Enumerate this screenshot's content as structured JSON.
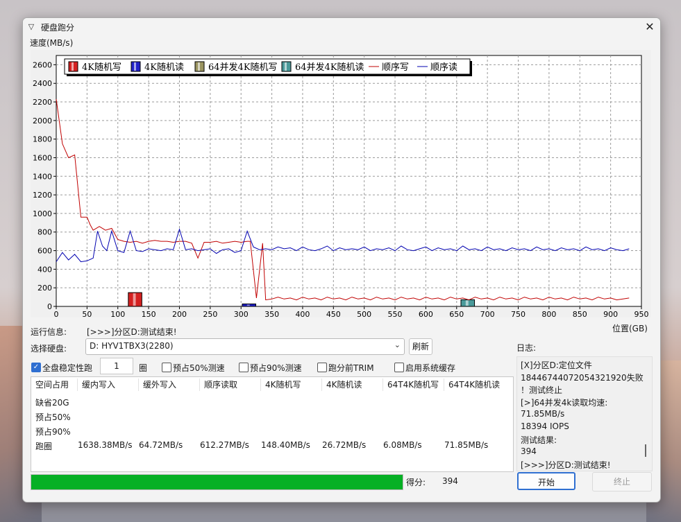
{
  "window": {
    "title": "硬盘跑分",
    "icon": "app-triangle-icon",
    "close_glyph": "✕"
  },
  "chart_data": {
    "type": "line",
    "ylabel": "速度(MB/s)",
    "xlabel": "位置(GB)",
    "xlim": [
      0,
      950
    ],
    "ylim": [
      0,
      2700
    ],
    "x_ticks": [
      0,
      50,
      100,
      150,
      200,
      250,
      300,
      350,
      400,
      450,
      500,
      550,
      600,
      650,
      700,
      750,
      800,
      850,
      900,
      950
    ],
    "y_ticks": [
      0,
      200,
      400,
      600,
      800,
      1000,
      1200,
      1400,
      1600,
      1800,
      2000,
      2200,
      2400,
      2600
    ],
    "grid": true,
    "legend_position": "top-left",
    "legend": [
      {
        "label": "4K随机写",
        "kind": "bar",
        "color": "#d42020"
      },
      {
        "label": "4K随机读",
        "kind": "bar",
        "color": "#2020c8"
      },
      {
        "label": "64并发4K随机写",
        "kind": "bar",
        "color": "#9a9460"
      },
      {
        "label": "64并发4K随机读",
        "kind": "bar",
        "color": "#4a9a9a"
      },
      {
        "label": "顺序写",
        "kind": "line",
        "color": "#c00000"
      },
      {
        "label": "顺序读",
        "kind": "line",
        "color": "#0000b0"
      }
    ],
    "bars": [
      {
        "series": "4K随机写",
        "x": 117,
        "width": 22,
        "value": 148.4,
        "color": "#d42020"
      },
      {
        "series": "4K随机读",
        "x": 302,
        "width": 22,
        "value": 26.7,
        "color": "#2020c8"
      },
      {
        "series": "64并发4K随机写",
        "x": 657,
        "width": 22,
        "value": 6.1,
        "color": "#9a9460"
      },
      {
        "series": "64并发4K随机读",
        "x": 657,
        "width": 22,
        "value": 71.9,
        "color": "#4a9a9a"
      }
    ],
    "series": [
      {
        "name": "顺序写",
        "color": "#c00000",
        "x": [
          0,
          10,
          20,
          30,
          40,
          50,
          55,
          60,
          70,
          80,
          90,
          100,
          110,
          120,
          130,
          140,
          150,
          160,
          170,
          180,
          190,
          200,
          210,
          220,
          230,
          240,
          250,
          260,
          270,
          280,
          290,
          300,
          310,
          315,
          325,
          335,
          340,
          350,
          360,
          370,
          380,
          390,
          400,
          410,
          420,
          430,
          440,
          450,
          460,
          470,
          480,
          490,
          500,
          510,
          520,
          530,
          540,
          550,
          560,
          570,
          580,
          590,
          600,
          610,
          620,
          630,
          640,
          650,
          660,
          670,
          680,
          690,
          700,
          710,
          720,
          730,
          740,
          750,
          760,
          770,
          780,
          790,
          800,
          810,
          820,
          830,
          840,
          850,
          860,
          870,
          880,
          890,
          900,
          910,
          920,
          930
        ],
        "values": [
          2230,
          1750,
          1600,
          1630,
          960,
          960,
          880,
          820,
          860,
          820,
          840,
          720,
          700,
          690,
          700,
          680,
          700,
          710,
          700,
          700,
          690,
          700,
          700,
          680,
          520,
          690,
          690,
          700,
          680,
          690,
          700,
          690,
          700,
          700,
          90,
          680,
          70,
          80,
          100,
          80,
          90,
          70,
          100,
          80,
          90,
          70,
          100,
          80,
          90,
          70,
          100,
          80,
          90,
          70,
          100,
          80,
          90,
          70,
          100,
          80,
          90,
          70,
          100,
          80,
          90,
          70,
          100,
          80,
          90,
          70,
          100,
          80,
          90,
          70,
          100,
          80,
          90,
          70,
          100,
          80,
          90,
          70,
          100,
          80,
          90,
          70,
          100,
          80,
          90,
          70,
          100,
          80,
          90,
          70,
          80,
          90
        ]
      },
      {
        "name": "顺序读",
        "color": "#0000b0",
        "x": [
          0,
          10,
          20,
          30,
          40,
          50,
          60,
          67,
          75,
          82,
          90,
          100,
          110,
          120,
          130,
          140,
          150,
          160,
          170,
          180,
          190,
          200,
          210,
          220,
          230,
          240,
          250,
          260,
          270,
          280,
          290,
          300,
          310,
          320,
          330,
          340,
          350,
          360,
          370,
          380,
          390,
          400,
          410,
          420,
          430,
          440,
          450,
          460,
          470,
          480,
          490,
          500,
          510,
          520,
          530,
          540,
          550,
          560,
          570,
          580,
          590,
          600,
          610,
          620,
          630,
          640,
          650,
          660,
          670,
          680,
          690,
          700,
          710,
          720,
          730,
          740,
          750,
          760,
          770,
          780,
          790,
          800,
          810,
          820,
          830,
          840,
          850,
          860,
          870,
          880,
          890,
          900,
          910,
          920,
          930
        ],
        "values": [
          480,
          580,
          500,
          560,
          480,
          490,
          520,
          810,
          650,
          600,
          810,
          600,
          580,
          810,
          600,
          590,
          620,
          610,
          600,
          620,
          610,
          830,
          610,
          620,
          600,
          610,
          620,
          570,
          610,
          620,
          580,
          600,
          810,
          640,
          610,
          620,
          610,
          640,
          620,
          630,
          600,
          640,
          610,
          600,
          620,
          650,
          600,
          630,
          610,
          620,
          610,
          640,
          600,
          620,
          610,
          630,
          600,
          650,
          610,
          600,
          620,
          640,
          600,
          630,
          610,
          620,
          600,
          650,
          610,
          620,
          600,
          640,
          610,
          620,
          600,
          630,
          610,
          620,
          600,
          640,
          610,
          620,
          600,
          630,
          610,
          620,
          600,
          640,
          610,
          620,
          600,
          630,
          610,
          600,
          620
        ]
      }
    ]
  },
  "info": {
    "run_label": "运行信息:",
    "run_value": "[>>>]分区D:测试结束!"
  },
  "disk": {
    "label": "选择硬盘:",
    "value": "D: HYV1TBX3(2280)",
    "refresh": "刷新"
  },
  "options": {
    "full_disk": {
      "label": "全盘稳定性跑",
      "checked": true
    },
    "rounds_value": "1",
    "rounds_unit": "圈",
    "pre50": {
      "label": "预占50%测速",
      "checked": false
    },
    "pre90": {
      "label": "预占90%测速",
      "checked": false
    },
    "trim": {
      "label": "跑分前TRIM",
      "checked": false
    },
    "cache": {
      "label": "启用系统缓存",
      "checked": false
    }
  },
  "table": {
    "headers": [
      "空间占用",
      "缓内写入",
      "缓外写入",
      "顺序读取",
      "4K随机写",
      "4K随机读",
      "64T4K随机写",
      "64T4K随机读"
    ],
    "rows": [
      [
        "缺省20G",
        "",
        "",
        "",
        "",
        "",
        "",
        ""
      ],
      [
        "预占50%",
        "",
        "",
        "",
        "",
        "",
        "",
        ""
      ],
      [
        "预占90%",
        "",
        "",
        "",
        "",
        "",
        "",
        ""
      ],
      [
        "跑圈",
        "1638.38MB/s",
        "64.72MB/s",
        "612.27MB/s",
        "148.40MB/s",
        "26.72MB/s",
        "6.08MB/s",
        "71.85MB/s"
      ]
    ]
  },
  "log": {
    "label": "日志:",
    "lines": [
      "[X]分区D:定位文件",
      "18446744072054321920失败",
      "！测试终止",
      "[>]64并发4k读取均速:",
      "71.85MB/s",
      "18394 IOPS",
      "测试结果:",
      "394",
      "[>>>]分区D:测试结束!"
    ]
  },
  "progress": {
    "fraction": 1.0,
    "color": "#06b025"
  },
  "score": {
    "label": "得分:",
    "value": "394"
  },
  "buttons": {
    "start": "开始",
    "stop": "终止"
  }
}
